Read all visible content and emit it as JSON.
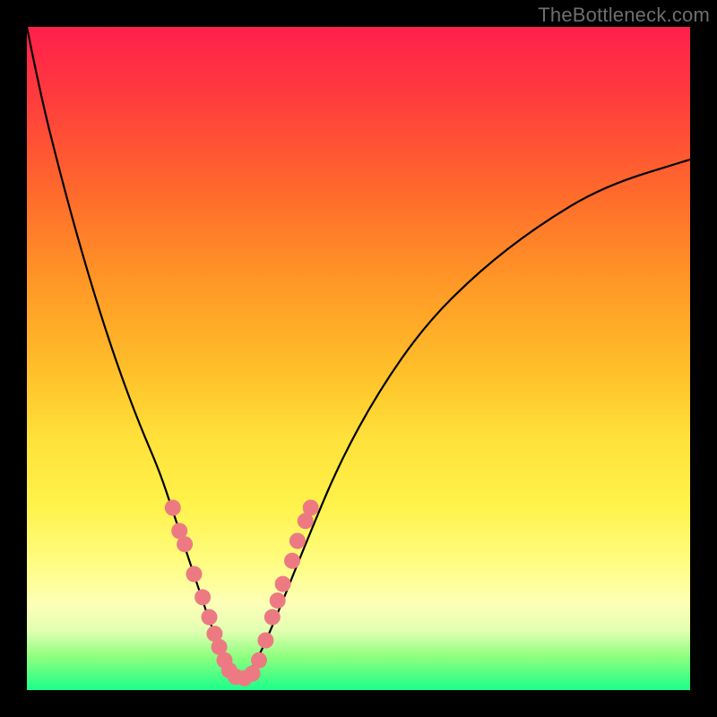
{
  "watermark": "TheBottleneck.com",
  "colors": {
    "frame": "#000000",
    "dot": "#ed7a82",
    "curve": "#000000",
    "gradient_stops": [
      {
        "pos": 0.0,
        "hex": "#ff1f4b"
      },
      {
        "pos": 0.1,
        "hex": "#ff3a3e"
      },
      {
        "pos": 0.25,
        "hex": "#ff6a2c"
      },
      {
        "pos": 0.38,
        "hex": "#ff9626"
      },
      {
        "pos": 0.52,
        "hex": "#ffc02a"
      },
      {
        "pos": 0.62,
        "hex": "#ffe13a"
      },
      {
        "pos": 0.72,
        "hex": "#fff24a"
      },
      {
        "pos": 0.81,
        "hex": "#fffd83"
      },
      {
        "pos": 0.87,
        "hex": "#fdffb7"
      },
      {
        "pos": 0.91,
        "hex": "#e2ffb2"
      },
      {
        "pos": 0.95,
        "hex": "#8dff7e"
      },
      {
        "pos": 1.0,
        "hex": "#1aff89"
      }
    ]
  },
  "chart_data": {
    "type": "line",
    "title": "",
    "xlabel": "",
    "ylabel": "",
    "xlim": [
      0,
      100
    ],
    "ylim": [
      0,
      100
    ],
    "series": [
      {
        "name": "bottleneck-curve",
        "x": [
          0,
          2,
          5,
          8,
          11,
          14,
          17,
          20,
          22,
          24,
          26,
          28,
          30,
          31,
          33,
          35,
          38,
          42,
          47,
          53,
          60,
          68,
          77,
          87,
          100
        ],
        "y": [
          100,
          90,
          78,
          67,
          57,
          48,
          40,
          33,
          27,
          21,
          15,
          9,
          5,
          2,
          2,
          5,
          12,
          22,
          34,
          45,
          55,
          63,
          70,
          76,
          80
        ]
      }
    ],
    "markers": [
      {
        "x": 22.0,
        "y": 27.5
      },
      {
        "x": 23.0,
        "y": 24.0
      },
      {
        "x": 23.8,
        "y": 22.0
      },
      {
        "x": 25.2,
        "y": 17.5
      },
      {
        "x": 26.5,
        "y": 14.0
      },
      {
        "x": 27.5,
        "y": 11.0
      },
      {
        "x": 28.3,
        "y": 8.5
      },
      {
        "x": 29.0,
        "y": 6.5
      },
      {
        "x": 29.8,
        "y": 4.5
      },
      {
        "x": 30.5,
        "y": 3.0
      },
      {
        "x": 31.5,
        "y": 2.0
      },
      {
        "x": 32.8,
        "y": 1.8
      },
      {
        "x": 34.0,
        "y": 2.5
      },
      {
        "x": 35.0,
        "y": 4.5
      },
      {
        "x": 36.0,
        "y": 7.5
      },
      {
        "x": 37.0,
        "y": 11.0
      },
      {
        "x": 37.8,
        "y": 13.5
      },
      {
        "x": 38.6,
        "y": 16.0
      },
      {
        "x": 40.0,
        "y": 19.5
      },
      {
        "x": 40.8,
        "y": 22.5
      },
      {
        "x": 42.0,
        "y": 25.5
      },
      {
        "x": 42.8,
        "y": 27.5
      }
    ],
    "marker_radius": 9
  }
}
